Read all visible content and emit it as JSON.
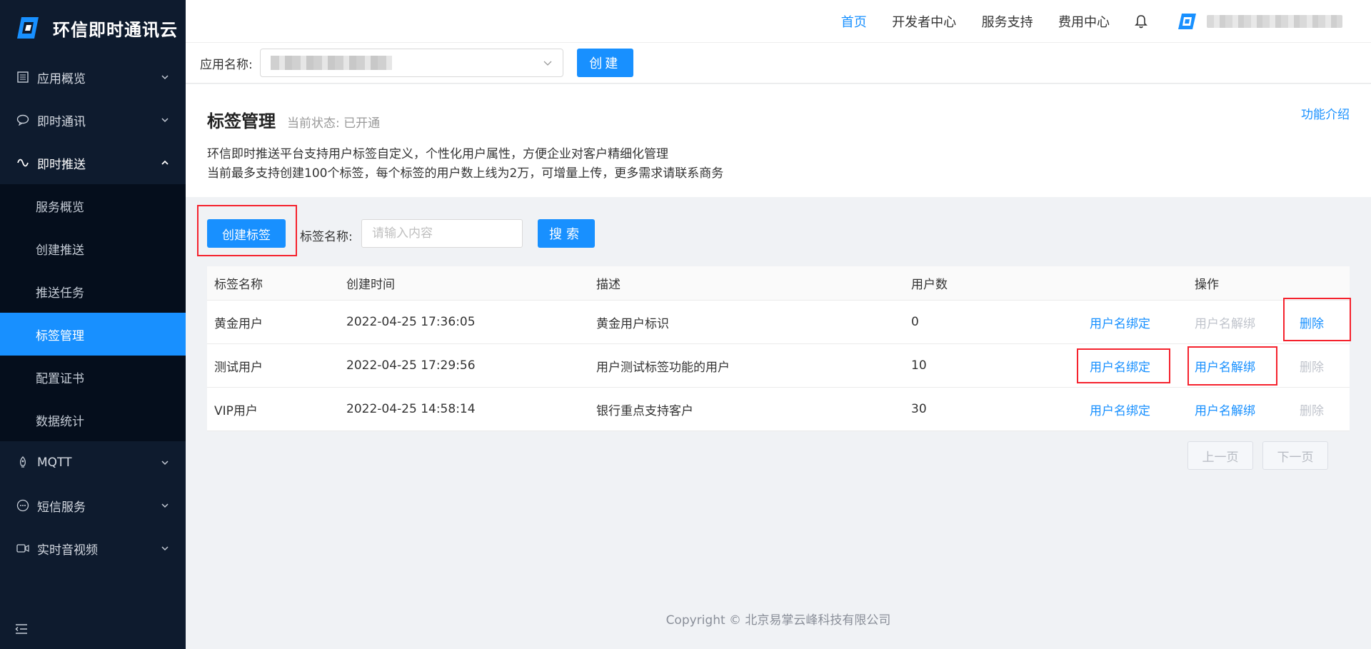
{
  "brand": {
    "name": "环信即时通讯云"
  },
  "sidebar": {
    "menus": [
      {
        "label": "应用概览",
        "icon": "list-icon"
      },
      {
        "label": "即时通讯",
        "icon": "chat-icon"
      },
      {
        "label": "即时推送",
        "icon": "push-icon"
      }
    ],
    "push_sub": [
      "服务概览",
      "创建推送",
      "推送任务",
      "标签管理",
      "配置证书",
      "数据统计"
    ],
    "menus_after": [
      {
        "label": "MQTT",
        "icon": "rocket-icon"
      },
      {
        "label": "短信服务",
        "icon": "sms-icon"
      },
      {
        "label": "实时音视频",
        "icon": "video-icon"
      }
    ]
  },
  "topnav": {
    "home": "首页",
    "dev": "开发者中心",
    "support": "服务支持",
    "billing": "费用中心"
  },
  "appbar": {
    "label": "应用名称:",
    "create": "创建"
  },
  "info": {
    "title": "标签管理",
    "status": "当前状态: 已开通",
    "intro_link": "功能介绍",
    "desc1": "环信即时推送平台支持用户标签自定义，个性化用户属性，方便企业对客户精细化管理",
    "desc2": "当前最多支持创建100个标签，每个标签的用户数上线为2万，可增量上传，更多需求请联系商务"
  },
  "toolbar": {
    "create_tag": "创建标签",
    "search_label": "标签名称:",
    "search_placeholder": "请输入内容",
    "search_btn": "搜索"
  },
  "table": {
    "headers": [
      "标签名称",
      "创建时间",
      "描述",
      "用户数",
      "操作"
    ],
    "rows": [
      {
        "name": "黄金用户",
        "time": "2022-04-25 17:36:05",
        "desc": "黄金用户标识",
        "count": "0",
        "bind": "用户名绑定",
        "unbind": "用户名解绑",
        "del": "删除"
      },
      {
        "name": "测试用户",
        "time": "2022-04-25 17:29:56",
        "desc": "用户测试标签功能的用户",
        "count": "10",
        "bind": "用户名绑定",
        "unbind": "用户名解绑",
        "del": "删除"
      },
      {
        "name": "VIP用户",
        "time": "2022-04-25 14:58:14",
        "desc": "银行重点支持客户",
        "count": "30",
        "bind": "用户名绑定",
        "unbind": "用户名解绑",
        "del": "删除"
      }
    ]
  },
  "pager": {
    "prev": "上一页",
    "next": "下一页"
  },
  "footer": {
    "copyright": "Copyright © 北京易掌云峰科技有限公司"
  },
  "colors": {
    "accent": "#1890ff",
    "sidebar_bg": "#0e1b2e",
    "highlight": "#f5222d"
  }
}
